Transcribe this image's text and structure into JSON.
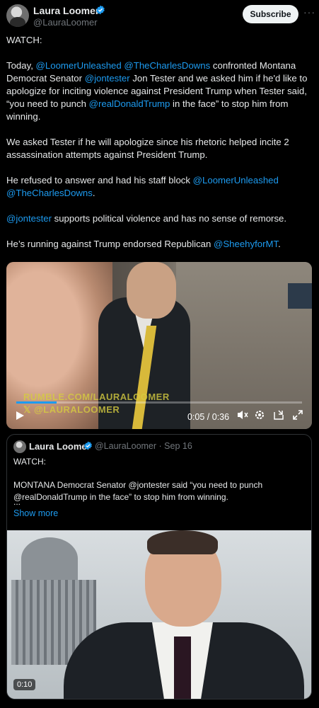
{
  "post": {
    "author_name": "Laura Loomer",
    "author_handle": "@LauraLoomer",
    "subscribe_label": "Subscribe",
    "more_glyph": "···",
    "text": {
      "p1": "WATCH:",
      "p2": {
        "t1": "Today, ",
        "m1": "@LoomerUnleashed",
        "t2": " ",
        "m2": "@TheCharlesDowns",
        "t3": " confronted Montana Democrat Senator ",
        "m3": "@jontester",
        "t4": " Jon Tester and we asked him if he'd like to apologize for inciting violence against President Trump when Tester said, “you need to punch ",
        "m4": "@realDonaldTrump",
        "t5": " in the face” to stop him from winning."
      },
      "p3": "We asked Tester if he will apologize since his rhetoric helped incite 2 assassination attempts against President Trump.",
      "p4": {
        "t1": "He refused to answer and had his staff block ",
        "m1": "@LoomerUnleashed",
        "t2": " ",
        "m2": "@TheCharlesDowns",
        "t3": "."
      },
      "p5": {
        "m1": "@jontester",
        "t1": " supports political violence and has no sense of remorse."
      },
      "p6": {
        "t1": "He’s running against Trump endorsed Republican ",
        "m1": "@SheehyforMT",
        "t2": "."
      }
    },
    "video": {
      "watermark_1": "RUMBLE.COM/LAURALOOMER",
      "watermark_2": "𝕏 @LAURALOOMER",
      "time": "0:05 / 0:36",
      "progress_fraction": 0.14
    }
  },
  "quote": {
    "author_name": "Laura Loomer",
    "meta": "@LauraLoomer · Sep 16",
    "p1": "WATCH:",
    "p2": "MONTANA Democrat Senator @jontester said “you need to punch @realDonaldTrump in the face” to stop him from winning.",
    "ellipsis": "...",
    "show_more": "Show more",
    "video_time": "0:10"
  },
  "colors": {
    "background": "#000000",
    "text": "#e7e9ea",
    "muted": "#71767b",
    "link": "#1d9bf0",
    "verified": "#1d9bf0",
    "subscribe_bg": "#eff3f4"
  },
  "icons": [
    "verified-badge-icon",
    "play-icon",
    "volume-icon",
    "settings-icon",
    "dock-icon",
    "fullscreen-icon",
    "more-icon"
  ]
}
